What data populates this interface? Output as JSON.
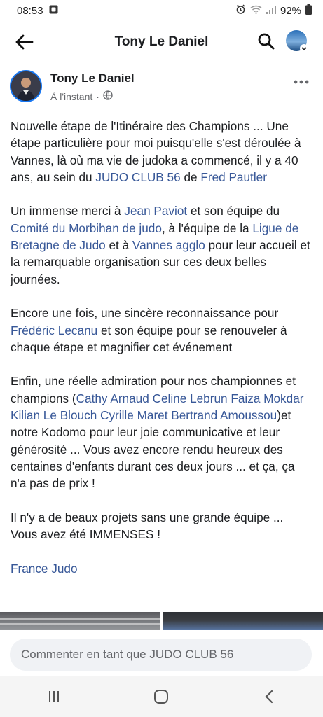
{
  "status_bar": {
    "time": "08:53",
    "battery": "92%"
  },
  "header": {
    "title": "Tony Le Daniel"
  },
  "post": {
    "author": "Tony Le Daniel",
    "time": "À l'instant",
    "separator": "·",
    "paragraphs": [
      [
        {
          "t": "Nouvelle étape de l'Itinéraire des Champions ... Une étape particulière pour moi puisqu'elle s'est déroulée à Vannes, là où ma vie de judoka a commencé, il y a 40 ans, au sein du "
        },
        {
          "t": "JUDO CLUB 56",
          "link": true
        },
        {
          "t": " de  "
        },
        {
          "t": "Fred Pautler",
          "link": true
        }
      ],
      [
        {
          "t": "Un immense merci à "
        },
        {
          "t": "Jean Paviot",
          "link": true
        },
        {
          "t": " et son équipe du "
        },
        {
          "t": "Comité du Morbihan de judo",
          "link": true
        },
        {
          "t": ", à l'équipe de la "
        },
        {
          "t": "Ligue de Bretagne de Judo",
          "link": true
        },
        {
          "t": " et à "
        },
        {
          "t": "Vannes agglo",
          "link": true
        },
        {
          "t": " pour leur accueil et la remarquable organisation sur ces deux belles journées."
        }
      ],
      [
        {
          "t": "Encore une fois, une sincère reconnaissance pour "
        },
        {
          "t": "Frédéric Lecanu",
          "link": true
        },
        {
          "t": " et son équipe pour se renouveler à chaque étape et magnifier cet événement"
        }
      ],
      [
        {
          "t": "Enfin, une réelle admiration pour nos championnes et champions ("
        },
        {
          "t": "Cathy Arnaud",
          "link": true
        },
        {
          "t": " "
        },
        {
          "t": "Celine Lebrun",
          "link": true
        },
        {
          "t": " "
        },
        {
          "t": "Faiza Mokdar",
          "link": true
        },
        {
          "t": " "
        },
        {
          "t": "Kilian Le Blouch",
          "link": true
        },
        {
          "t": " "
        },
        {
          "t": "Cyrille Maret",
          "link": true
        },
        {
          "t": " "
        },
        {
          "t": "Bertrand Amoussou",
          "link": true
        },
        {
          "t": ")et notre Kodomo pour leur joie communicative et leur générosité ... Vous avez encore rendu heureux des centaines d'enfants durant ces deux jours ... et ça, ça n'a pas de prix !"
        }
      ],
      [
        {
          "t": "Il n'y a de beaux projets sans une grande équipe ... Vous avez été IMMENSES !"
        }
      ],
      [
        {
          "t": "France Judo",
          "link": true
        }
      ]
    ]
  },
  "comment_bar": {
    "placeholder": "Commenter en tant que JUDO CLUB 56"
  },
  "nav": {
    "recents": "|||"
  },
  "colors": {
    "accent": "#1877f2",
    "link": "#385898",
    "text": "#1c1e21",
    "muted": "#65676b"
  }
}
